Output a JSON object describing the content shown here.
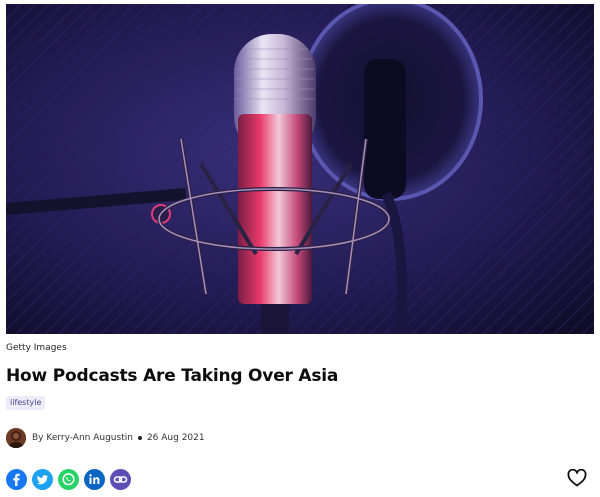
{
  "hero": {
    "icon": "podcast-microphone-photo"
  },
  "article": {
    "image_credit": "Getty Images",
    "title": "How Podcasts Are Taking Over Asia",
    "tag": "lifestyle",
    "author": "By Kerry-Ann Augustin",
    "date": "26 Aug 2021"
  },
  "share": [
    {
      "name": "facebook",
      "color": "#1877f2",
      "icon": "facebook-icon"
    },
    {
      "name": "twitter",
      "color": "#1da1f2",
      "icon": "twitter-icon"
    },
    {
      "name": "whatsapp",
      "color": "#25d366",
      "icon": "whatsapp-icon"
    },
    {
      "name": "linkedin",
      "color": "#0a66c2",
      "icon": "linkedin-icon"
    },
    {
      "name": "copy-link",
      "color": "#5b4fb4",
      "icon": "link-icon"
    }
  ],
  "colors": {
    "accent": "#5b4fb4",
    "tag_bg": "#ecebf7"
  }
}
